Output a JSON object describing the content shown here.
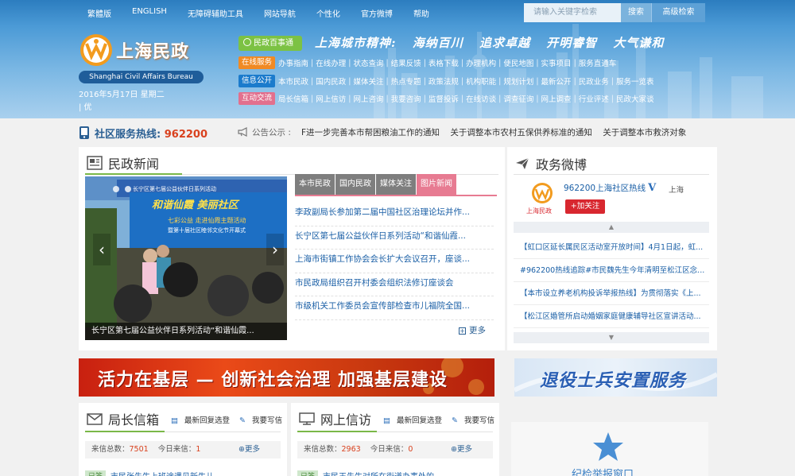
{
  "topnav": {
    "items": [
      "繁體版",
      "ENGLISH",
      "无障碍辅助工具",
      "网站导航",
      "个性化",
      "官方微博",
      "帮助"
    ],
    "search_placeholder": "请输入关键字检索",
    "search_button": "搜索",
    "advanced_search": "高级检索"
  },
  "logo": {
    "title": "上海民政",
    "subtitle_en": "Shanghai Civil Affairs Bureau"
  },
  "date": "2016年5月17日 星期二",
  "weather": "| 优",
  "slogan_badge": "民政百事通",
  "slogan": "上海城市精神: 海纳百川 追求卓越 开明睿智 大气谦和",
  "menus": [
    {
      "tag": "在线服务",
      "items": [
        "办事指南",
        "在线办理",
        "状态查询",
        "结果反馈",
        "表格下载",
        "办理机构",
        "便民地图",
        "实事项目",
        "服务直通车"
      ]
    },
    {
      "tag": "信息公开",
      "items": [
        "本市民政",
        "国内民政",
        "媒体关注",
        "热点专题",
        "政策法规",
        "机构职能",
        "规划计划",
        "最新公开",
        "民政业务",
        "服务一览表"
      ]
    },
    {
      "tag": "互动交流",
      "items": [
        "局长信箱",
        "网上信访",
        "网上咨询",
        "我要咨询",
        "监督投诉",
        "在线访谈",
        "调查征询",
        "网上调查",
        "行业评述",
        "民政大家谈"
      ]
    }
  ],
  "hotline": {
    "label": "社区服务热线:",
    "number": "962200"
  },
  "notice": {
    "label": "公告公示 :",
    "items": [
      "F进一步完善本市帮困粮油工作的通知",
      "关于调整本市农村五保供养标准的通知",
      "关于调整本市救济对象"
    ]
  },
  "news": {
    "title": "民政新闻",
    "slide_caption": "长宁区第七届公益伙伴日系列活动“和谐仙霞...",
    "slide_banner": "长宁区第七届公益伙伴日系列活动",
    "slide_event": "七彩公益  走进仙霞主题活动",
    "slide_event2": "暨第十届社区睦邻文化节开幕式",
    "slide_art": "和谐仙霞 美丽社区",
    "tabs": [
      "本市民政",
      "国内民政",
      "媒体关注",
      "图片新闻"
    ],
    "items": [
      "李政副局长参加第二届中国社区治理论坛并作...",
      "长宁区第七届公益伙伴日系列活动“和谐仙霞...",
      "上海市街镇工作协会会长扩大会议召开，座谈...",
      "市民政局组织召开村委会组织法修订座谈会",
      "市级机关工作委员会宣传部检查市儿福院全国..."
    ],
    "more": "更多"
  },
  "weibo": {
    "title": "政务微博",
    "avatar_text": "上海民政",
    "account": "962200上海社区热线",
    "verified": "V",
    "city": "上海",
    "follow": "+加关注",
    "items": [
      "【虹口区延长属民区活动室开放时间】4月1日起，虹...",
      "#962200热线追踪#市民魏先生今年清明至松江区念...",
      "【本市设立养老机构投诉举报热线】为贯彻落实《上...",
      "【松江区婚管所启动婚姻家庭健康辅导社区宣讲活动..."
    ]
  },
  "banners": {
    "left": "活力在基层 — 创新社会治理  加强基层建设",
    "right": "退役士兵安置服务"
  },
  "mailbox": {
    "title": "局长信箱",
    "link1": "最新回复选登",
    "link2": "我要写信",
    "total_label": "来信总数：",
    "total": "7501",
    "today_label": "今日来信：",
    "today": "1",
    "more": "更多",
    "item_badge": "已答",
    "item_text": "市民张先生上班途遇见新生儿..."
  },
  "visit": {
    "title": "网上信访",
    "link1": "最新回复选登",
    "link2": "我要写信",
    "total_label": "来信总数：",
    "total": "2963",
    "today_label": "今日来信：",
    "today": "0",
    "more": "更多",
    "item_badge": "已答",
    "item_text": "市民王先生对所在街道办事处的..."
  },
  "report": {
    "label": "纪检举报窗口"
  },
  "colors": {
    "header_blue": "#4b9ad6",
    "accent_green": "#7ab848",
    "tab_pink": "#e77b92",
    "hotline_red": "#d9411e"
  }
}
